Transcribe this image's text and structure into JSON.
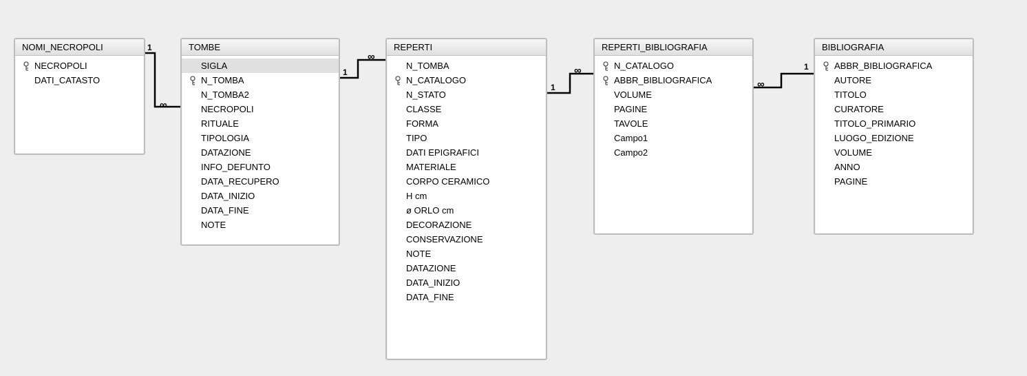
{
  "tables": {
    "nomi_necropoli": {
      "title": "NOMI_NECROPOLI",
      "fields": [
        {
          "name": "NECROPOLI",
          "key": true
        },
        {
          "name": "DATI_CATASTO",
          "key": false
        }
      ]
    },
    "tombe": {
      "title": "TOMBE",
      "fields": [
        {
          "name": "SIGLA",
          "key": false,
          "highlight": true
        },
        {
          "name": "N_TOMBA",
          "key": true
        },
        {
          "name": "N_TOMBA2",
          "key": false
        },
        {
          "name": "NECROPOLI",
          "key": false
        },
        {
          "name": "RITUALE",
          "key": false
        },
        {
          "name": "TIPOLOGIA",
          "key": false
        },
        {
          "name": "DATAZIONE",
          "key": false
        },
        {
          "name": "INFO_DEFUNTO",
          "key": false
        },
        {
          "name": "DATA_RECUPERO",
          "key": false
        },
        {
          "name": "DATA_INIZIO",
          "key": false
        },
        {
          "name": "DATA_FINE",
          "key": false
        },
        {
          "name": "NOTE",
          "key": false
        }
      ]
    },
    "reperti": {
      "title": "REPERTI",
      "fields": [
        {
          "name": "N_TOMBA",
          "key": false
        },
        {
          "name": "N_CATALOGO",
          "key": true
        },
        {
          "name": "N_STATO",
          "key": false
        },
        {
          "name": "CLASSE",
          "key": false
        },
        {
          "name": "FORMA",
          "key": false
        },
        {
          "name": "TIPO",
          "key": false
        },
        {
          "name": "DATI EPIGRAFICI",
          "key": false
        },
        {
          "name": "MATERIALE",
          "key": false
        },
        {
          "name": "CORPO CERAMICO",
          "key": false
        },
        {
          "name": "H cm",
          "key": false
        },
        {
          "name": "ø ORLO cm",
          "key": false
        },
        {
          "name": "DECORAZIONE",
          "key": false
        },
        {
          "name": "CONSERVAZIONE",
          "key": false
        },
        {
          "name": "NOTE",
          "key": false
        },
        {
          "name": "DATAZIONE",
          "key": false
        },
        {
          "name": "DATA_INIZIO",
          "key": false
        },
        {
          "name": "DATA_FINE",
          "key": false
        }
      ]
    },
    "reperti_bibliografia": {
      "title": "REPERTI_BIBLIOGRAFIA",
      "fields": [
        {
          "name": "N_CATALOGO",
          "key": true
        },
        {
          "name": "ABBR_BIBLIOGRAFICA",
          "key": true
        },
        {
          "name": "VOLUME",
          "key": false
        },
        {
          "name": "PAGINE",
          "key": false
        },
        {
          "name": "TAVOLE",
          "key": false
        },
        {
          "name": "Campo1",
          "key": false
        },
        {
          "name": "Campo2",
          "key": false
        }
      ]
    },
    "bibliografia": {
      "title": "BIBLIOGRAFIA",
      "fields": [
        {
          "name": "ABBR_BIBLIOGRAFICA",
          "key": true
        },
        {
          "name": "AUTORE",
          "key": false
        },
        {
          "name": "TITOLO",
          "key": false
        },
        {
          "name": "CURATORE",
          "key": false
        },
        {
          "name": "TITOLO_PRIMARIO",
          "key": false
        },
        {
          "name": "LUOGO_EDIZIONE",
          "key": false
        },
        {
          "name": "VOLUME",
          "key": false
        },
        {
          "name": "ANNO",
          "key": false
        },
        {
          "name": "PAGINE",
          "key": false
        }
      ]
    }
  },
  "relations": [
    {
      "from": "nomi_necropoli",
      "to": "tombe",
      "from_card": "1",
      "to_card": "∞"
    },
    {
      "from": "tombe",
      "to": "reperti",
      "from_card": "1",
      "to_card": "∞"
    },
    {
      "from": "reperti",
      "to": "reperti_bibliografia",
      "from_card": "1",
      "to_card": "∞"
    },
    {
      "from": "reperti_bibliografia",
      "to": "bibliografia",
      "from_card": "∞",
      "to_card": "1"
    }
  ],
  "labels": {
    "one": "1",
    "inf": "∞"
  }
}
